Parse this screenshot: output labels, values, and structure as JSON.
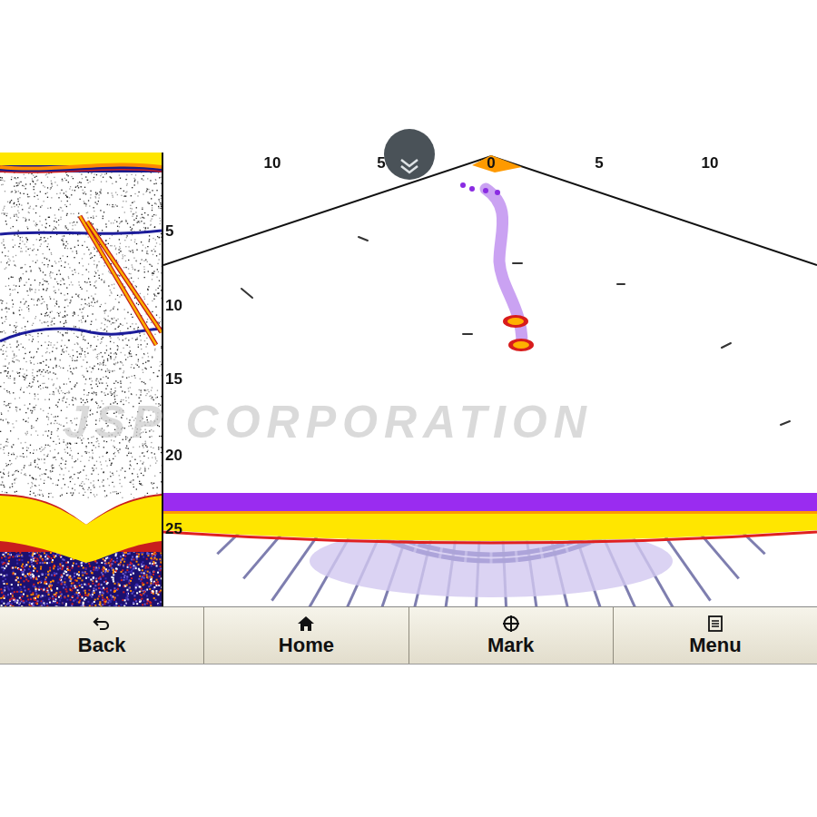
{
  "range_scale": [
    "10",
    "5",
    "0",
    "5",
    "10"
  ],
  "depth_scale": [
    "5",
    "10",
    "15",
    "20",
    "25"
  ],
  "watermark": "JSP CORPORATION",
  "buttons": [
    {
      "label": "Back",
      "kind": "back"
    },
    {
      "label": "Home",
      "kind": "home"
    },
    {
      "label": "Mark",
      "kind": "mark"
    },
    {
      "label": "Menu",
      "kind": "menu"
    }
  ]
}
